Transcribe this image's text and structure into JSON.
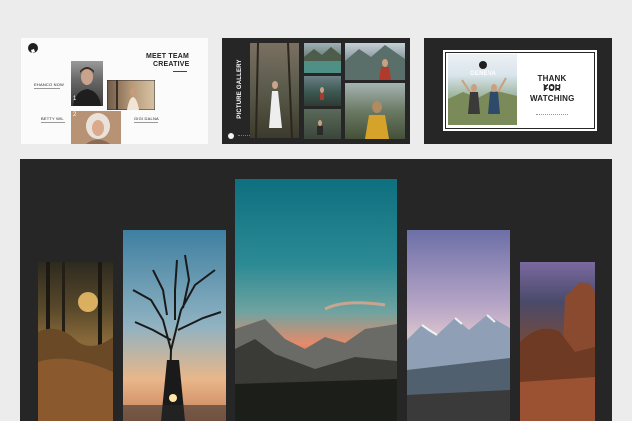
{
  "slides": {
    "team": {
      "title_line1": "MEET TEAM",
      "title_line2": "CREATIVE",
      "member1_name": "EHANCO NOW",
      "member2_name": "BETTY WIL",
      "member3_name": "GIGI DALNA",
      "num1": "1",
      "num2": "2"
    },
    "gallery": {
      "title": "PICTURE GALLERY"
    },
    "thanks": {
      "brand": "GENEVA",
      "line1": "THANK YOU",
      "line2": "FOR",
      "line3": "WATCHING"
    }
  },
  "colors": {
    "page_bg": "#ececec",
    "dark_bg": "#262626",
    "accent_text": "#1f1f1f"
  }
}
